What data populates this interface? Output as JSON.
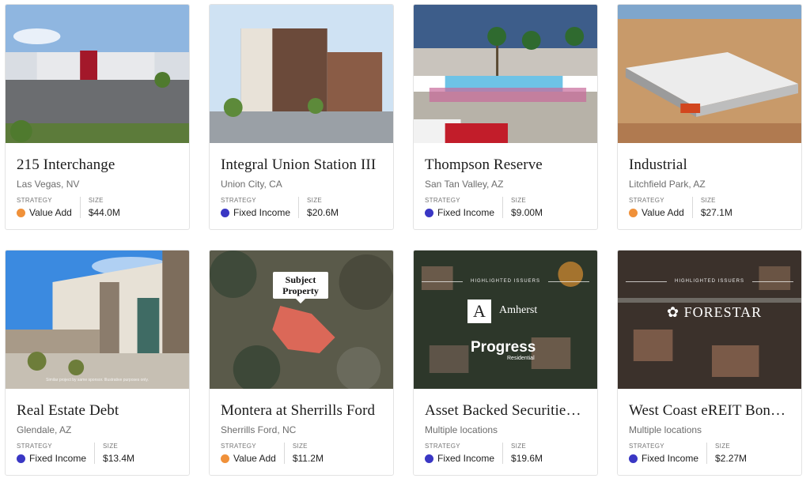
{
  "colors": {
    "value_add": "#f0913a",
    "fixed_income": "#3a37c4"
  },
  "labels": {
    "strategy": "STRATEGY",
    "size": "SIZE"
  },
  "cards": [
    {
      "title": "215 Interchange",
      "location": "Las Vegas, NV",
      "strategy": "Value Add",
      "strategy_color": "#f0913a",
      "size": "$44.0M"
    },
    {
      "title": "Integral Union Station III",
      "location": "Union City, CA",
      "strategy": "Fixed Income",
      "strategy_color": "#3a37c4",
      "size": "$20.6M"
    },
    {
      "title": "Thompson Reserve",
      "location": "San Tan Valley, AZ",
      "strategy": "Fixed Income",
      "strategy_color": "#3a37c4",
      "size": "$9.00M"
    },
    {
      "title": "Industrial",
      "location": "Litchfield Park, AZ",
      "strategy": "Value Add",
      "strategy_color": "#f0913a",
      "size": "$27.1M"
    },
    {
      "title": "Real Estate Debt",
      "location": "Glendale, AZ",
      "strategy": "Fixed Income",
      "strategy_color": "#3a37c4",
      "size": "$13.4M",
      "image_caption": "Similar project by same sponsor. Illustrative purposes only."
    },
    {
      "title": "Montera at Sherrills Ford",
      "location": "Sherrills Ford, NC",
      "strategy": "Value Add",
      "strategy_color": "#f0913a",
      "size": "$11.2M",
      "callout": "Subject Property"
    },
    {
      "title": "Asset Backed Securities ...",
      "location": "Multiple locations",
      "strategy": "Fixed Income",
      "strategy_color": "#3a37c4",
      "size": "$19.6M",
      "overlay_label": "HIGHLIGHTED ISSUERS",
      "overlay_issuers": [
        "Amherst",
        "Progress",
        "Residential"
      ]
    },
    {
      "title": "West Coast eREIT Bond ...",
      "location": "Multiple locations",
      "strategy": "Fixed Income",
      "strategy_color": "#3a37c4",
      "size": "$2.27M",
      "overlay_label": "HIGHLIGHTED ISSUERS",
      "overlay_issuers": [
        "FORESTAR"
      ]
    }
  ]
}
